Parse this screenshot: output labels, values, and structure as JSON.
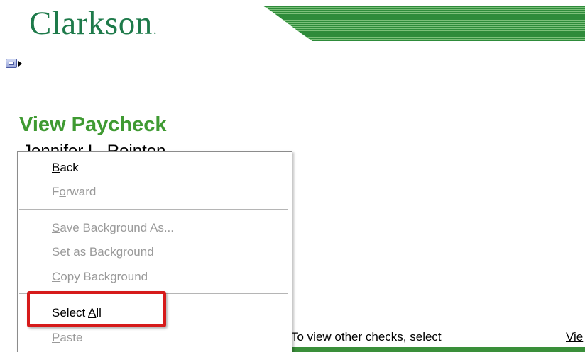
{
  "header": {
    "logo_text": "Clarkson",
    "logo_mark": ".",
    "brand_color": "#1e7a4a",
    "banner_color": "#2e8b3a"
  },
  "nav": {
    "menu_toggle_icon": "menu-window-icon"
  },
  "main": {
    "title": "View Paycheck",
    "title_color": "#3f9a32",
    "employee_name_partial": "Jennifer L. Reinton",
    "instruction": "To view other checks, select",
    "view_link": "Vie"
  },
  "context_menu": {
    "items": [
      {
        "label": "Back",
        "accel_index": 0,
        "enabled": true
      },
      {
        "label": "Forward",
        "accel_index": 1,
        "enabled": false
      },
      {
        "separator": true
      },
      {
        "label": "Save Background As...",
        "accel_index": 0,
        "enabled": false
      },
      {
        "label": "Set as Background",
        "accel_index": -1,
        "enabled": false
      },
      {
        "label": "Copy Background",
        "accel_index": 0,
        "enabled": false
      },
      {
        "separator": true
      },
      {
        "label": "Select All",
        "accel_index": 7,
        "enabled": true,
        "highlighted": true
      },
      {
        "label": "Paste",
        "accel_index": 0,
        "enabled": false
      }
    ],
    "highlight_color": "#d61a1a"
  }
}
